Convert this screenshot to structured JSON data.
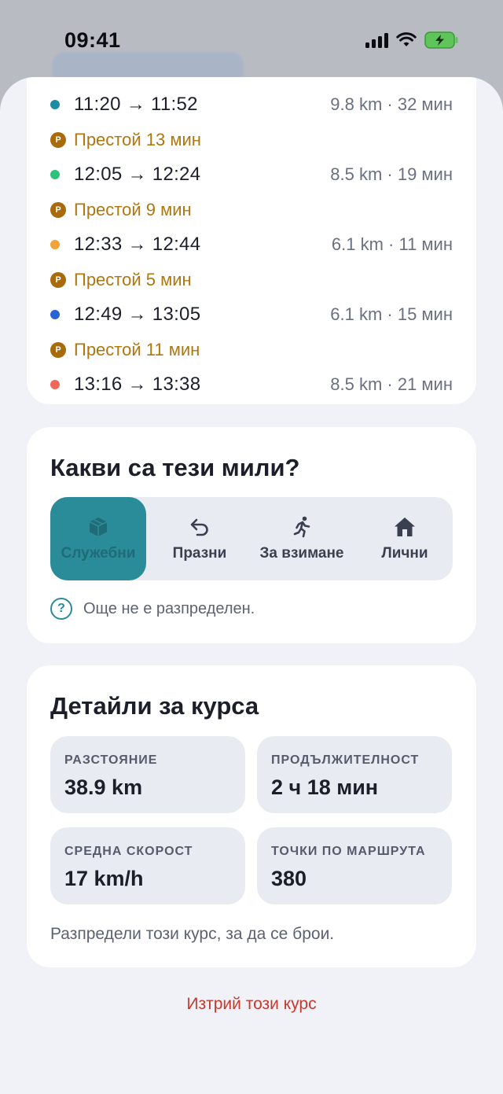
{
  "status_bar": {
    "time": "09:41"
  },
  "segments": [
    {
      "type": "drive",
      "time": "11:20 → 11:52",
      "meta": "9.8 km · 32 мин",
      "color": "#1d8ca3"
    },
    {
      "type": "stop",
      "label": "Престой 13 мин",
      "badge": "P"
    },
    {
      "type": "drive",
      "time": "12:05 → 12:24",
      "meta": "8.5 km · 19 мин",
      "color": "#2ec27e"
    },
    {
      "type": "stop",
      "label": "Престой 9 мин",
      "badge": "P"
    },
    {
      "type": "drive",
      "time": "12:33 → 12:44",
      "meta": "6.1 km · 11 мин",
      "color": "#f2a33a"
    },
    {
      "type": "stop",
      "label": "Престой 5 мин",
      "badge": "P"
    },
    {
      "type": "drive",
      "time": "12:49 → 13:05",
      "meta": "6.1 km · 15 мин",
      "color": "#2a63d4"
    },
    {
      "type": "stop",
      "label": "Престой 11 мин",
      "badge": "P"
    },
    {
      "type": "drive",
      "time": "13:16 → 13:38",
      "meta": "8.5 km · 21 мин",
      "color": "#f0685a"
    }
  ],
  "classification": {
    "title": "Какви са тези мили?",
    "options": [
      {
        "label": "Служебни",
        "icon": "box-icon",
        "active": true
      },
      {
        "label": "Празни",
        "icon": "undo-arrow-icon",
        "active": false
      },
      {
        "label": "За взимане",
        "icon": "running-person-icon",
        "active": false
      },
      {
        "label": "Лични",
        "icon": "home-icon",
        "active": false
      }
    ],
    "hint": "Още не е разпределен."
  },
  "details": {
    "title": "Детайли за курса",
    "stats": [
      {
        "label": "РАЗСТОЯНИЕ",
        "value": "38.9 km"
      },
      {
        "label": "ПРОДЪЛЖИТЕЛНОСТ",
        "value": "2 ч 18 мин"
      },
      {
        "label": "СРЕДНА СКОРОСТ",
        "value": "17 km/h"
      },
      {
        "label": "ТОЧКИ ПО МАРШРУТА",
        "value": "380"
      }
    ],
    "note": "Разпредели този курс, за да се брои."
  },
  "delete_label": "Изтрий този курс",
  "colors": {
    "accent": "#2a8c99",
    "stop": "#b0760f",
    "danger": "#c9392c"
  }
}
